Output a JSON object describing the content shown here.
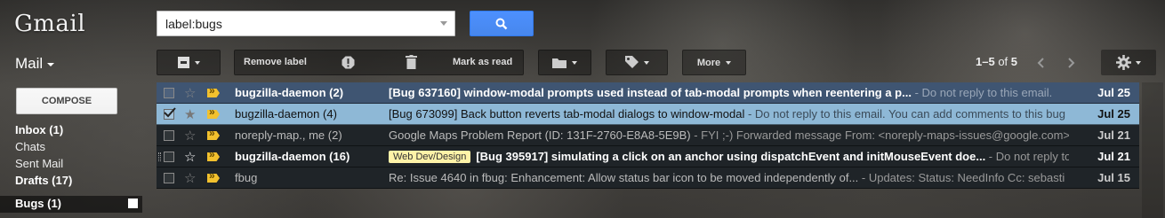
{
  "app": {
    "logo": "Gmail",
    "view_label": "Mail"
  },
  "search": {
    "value": "label:bugs"
  },
  "toolbar": {
    "remove_label": "Remove label",
    "mark_as_read": "Mark as read",
    "more": "More"
  },
  "paging": {
    "range": "1–5",
    "of": "of",
    "total": "5"
  },
  "sidebar": {
    "compose": "COMPOSE",
    "items": [
      {
        "label": "Inbox (1)"
      },
      {
        "label": "Chats"
      },
      {
        "label": "Sent Mail"
      },
      {
        "label": "Drafts (17)"
      },
      {
        "label": "Bugs (1)"
      }
    ]
  },
  "messages": [
    {
      "sender": "bugzilla-daemon (2)",
      "subject": "[Bug 637160] window-modal prompts used instead of tab-modal prompts when reentering a p...",
      "snippet": " - Do not reply to this email.",
      "date": "Jul 25",
      "state": "unread"
    },
    {
      "sender": "bugzilla-daemon (4)",
      "subject": "[Bug 673099] Back button reverts tab-modal dialogs to window-modal",
      "snippet": " - Do not reply to this email. You can add comments to this bug",
      "date": "Jul 25",
      "state": "selected"
    },
    {
      "sender": "noreply-map., me (2)",
      "subject": "Google Maps Problem Report (ID: 131F-2760-E8A8-5E9B)",
      "snippet": " - FYI ;-) Forwarded message From: <noreply-maps-issues@google.com>",
      "date": "Jul 21",
      "state": "read"
    },
    {
      "sender": "bugzilla-daemon (16)",
      "label": "Web Dev/Design",
      "subject": "[Bug 395917] simulating a click on an anchor using dispatchEvent and initMouseEvent doe...",
      "snippet": " - Do not reply to this e",
      "date": "Jul 21",
      "state": "unread-dark"
    },
    {
      "sender": "fbug",
      "subject": "Re: Issue 4640 in fbug: Enhancement: Allow status bar icon to be moved independently of...",
      "snippet": " - Updates: Status: NeedInfo Cc: sebasti",
      "date": "Jul 15",
      "state": "read"
    }
  ]
}
